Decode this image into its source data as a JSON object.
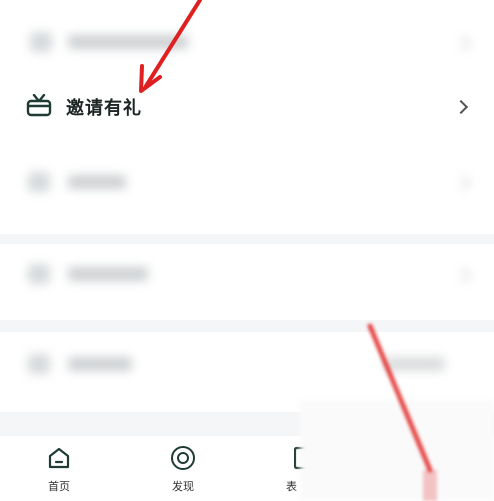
{
  "menu": {
    "invite_label": "邀请有礼"
  },
  "tabs": [
    {
      "label": "首页"
    },
    {
      "label": "发现"
    },
    {
      "label": "表"
    }
  ],
  "colors": {
    "accent": "#e02020",
    "icon_dark": "#1f3b36"
  }
}
